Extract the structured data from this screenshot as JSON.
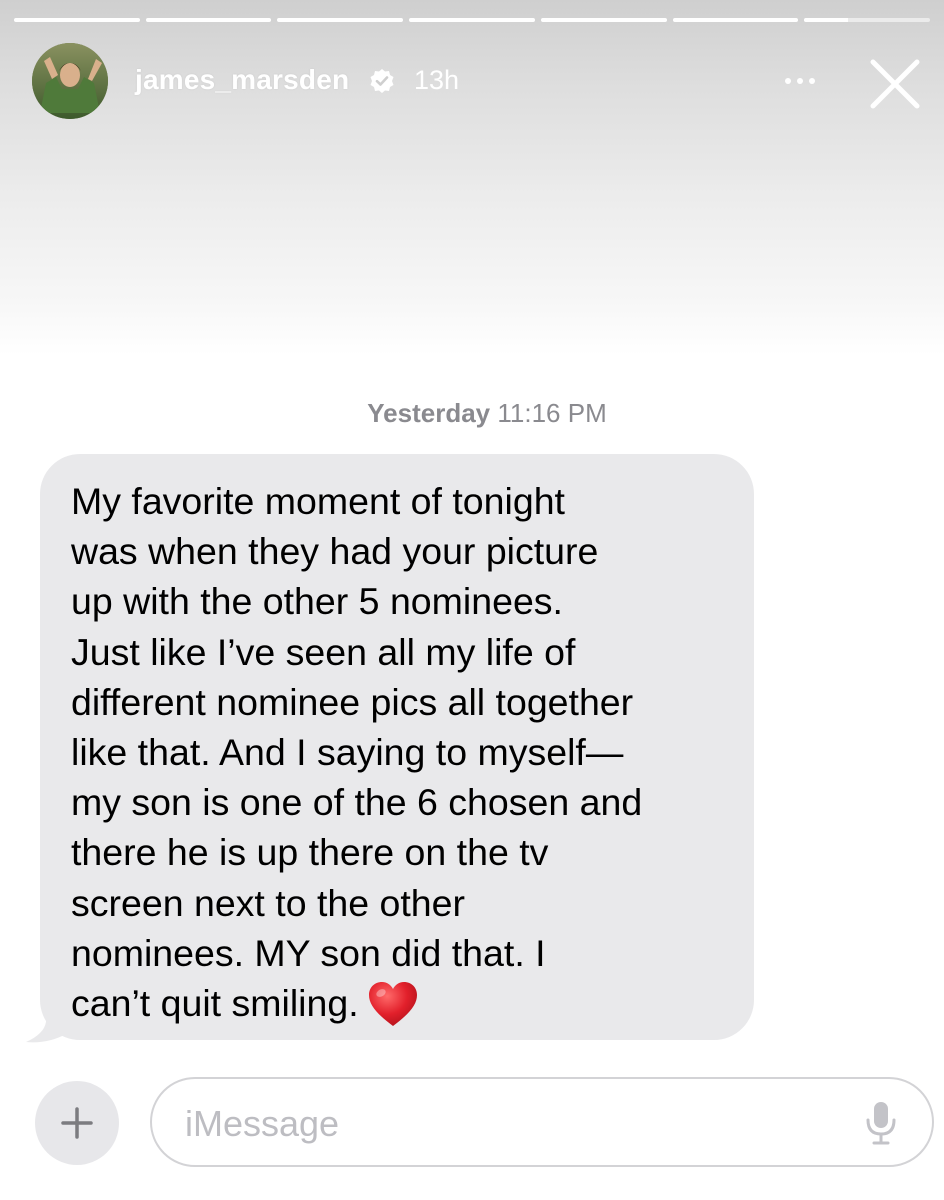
{
  "story": {
    "username": "james_marsden",
    "verified": true,
    "time_ago": "13h",
    "segments": [
      1,
      1,
      1,
      1,
      1,
      1,
      0.35
    ]
  },
  "thread": {
    "timestamp_day": "Yesterday",
    "timestamp_time": "11:16 PM",
    "message_text": "My favorite moment of tonight\nwas when they had your picture\nup with the other 5 nominees.\nJust like I’ve seen all my life of\ndifferent nominee pics all together\nlike that.  And I saying to myself—\nmy son is one of the 6 chosen and\nthere he is up there on the tv\nscreen next to the other\nnominees.  MY son did that.  I\ncan’t quit smiling.",
    "emoji": "red-heart"
  },
  "composer": {
    "placeholder": "iMessage"
  },
  "colors": {
    "bubble": "#e9e9eb",
    "heart": "#e2202b",
    "timestamp": "#8a8a8f"
  }
}
